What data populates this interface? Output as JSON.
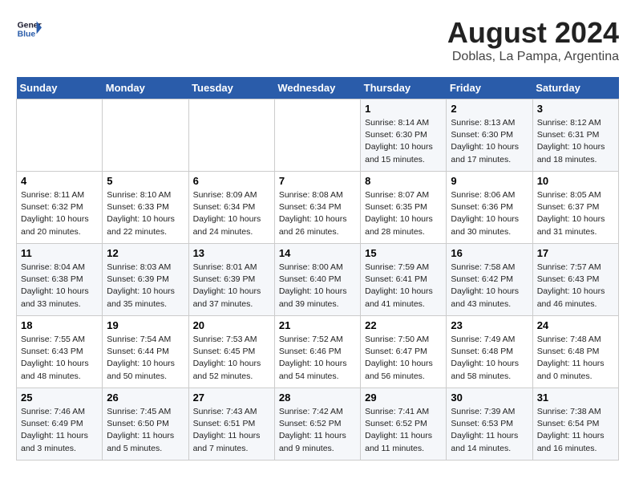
{
  "header": {
    "logo_line1": "General",
    "logo_line2": "Blue",
    "month_title": "August 2024",
    "location": "Doblas, La Pampa, Argentina"
  },
  "weekdays": [
    "Sunday",
    "Monday",
    "Tuesday",
    "Wednesday",
    "Thursday",
    "Friday",
    "Saturday"
  ],
  "weeks": [
    [
      {
        "day": "",
        "info": ""
      },
      {
        "day": "",
        "info": ""
      },
      {
        "day": "",
        "info": ""
      },
      {
        "day": "",
        "info": ""
      },
      {
        "day": "1",
        "info": "Sunrise: 8:14 AM\nSunset: 6:30 PM\nDaylight: 10 hours\nand 15 minutes."
      },
      {
        "day": "2",
        "info": "Sunrise: 8:13 AM\nSunset: 6:30 PM\nDaylight: 10 hours\nand 17 minutes."
      },
      {
        "day": "3",
        "info": "Sunrise: 8:12 AM\nSunset: 6:31 PM\nDaylight: 10 hours\nand 18 minutes."
      }
    ],
    [
      {
        "day": "4",
        "info": "Sunrise: 8:11 AM\nSunset: 6:32 PM\nDaylight: 10 hours\nand 20 minutes."
      },
      {
        "day": "5",
        "info": "Sunrise: 8:10 AM\nSunset: 6:33 PM\nDaylight: 10 hours\nand 22 minutes."
      },
      {
        "day": "6",
        "info": "Sunrise: 8:09 AM\nSunset: 6:34 PM\nDaylight: 10 hours\nand 24 minutes."
      },
      {
        "day": "7",
        "info": "Sunrise: 8:08 AM\nSunset: 6:34 PM\nDaylight: 10 hours\nand 26 minutes."
      },
      {
        "day": "8",
        "info": "Sunrise: 8:07 AM\nSunset: 6:35 PM\nDaylight: 10 hours\nand 28 minutes."
      },
      {
        "day": "9",
        "info": "Sunrise: 8:06 AM\nSunset: 6:36 PM\nDaylight: 10 hours\nand 30 minutes."
      },
      {
        "day": "10",
        "info": "Sunrise: 8:05 AM\nSunset: 6:37 PM\nDaylight: 10 hours\nand 31 minutes."
      }
    ],
    [
      {
        "day": "11",
        "info": "Sunrise: 8:04 AM\nSunset: 6:38 PM\nDaylight: 10 hours\nand 33 minutes."
      },
      {
        "day": "12",
        "info": "Sunrise: 8:03 AM\nSunset: 6:39 PM\nDaylight: 10 hours\nand 35 minutes."
      },
      {
        "day": "13",
        "info": "Sunrise: 8:01 AM\nSunset: 6:39 PM\nDaylight: 10 hours\nand 37 minutes."
      },
      {
        "day": "14",
        "info": "Sunrise: 8:00 AM\nSunset: 6:40 PM\nDaylight: 10 hours\nand 39 minutes."
      },
      {
        "day": "15",
        "info": "Sunrise: 7:59 AM\nSunset: 6:41 PM\nDaylight: 10 hours\nand 41 minutes."
      },
      {
        "day": "16",
        "info": "Sunrise: 7:58 AM\nSunset: 6:42 PM\nDaylight: 10 hours\nand 43 minutes."
      },
      {
        "day": "17",
        "info": "Sunrise: 7:57 AM\nSunset: 6:43 PM\nDaylight: 10 hours\nand 46 minutes."
      }
    ],
    [
      {
        "day": "18",
        "info": "Sunrise: 7:55 AM\nSunset: 6:43 PM\nDaylight: 10 hours\nand 48 minutes."
      },
      {
        "day": "19",
        "info": "Sunrise: 7:54 AM\nSunset: 6:44 PM\nDaylight: 10 hours\nand 50 minutes."
      },
      {
        "day": "20",
        "info": "Sunrise: 7:53 AM\nSunset: 6:45 PM\nDaylight: 10 hours\nand 52 minutes."
      },
      {
        "day": "21",
        "info": "Sunrise: 7:52 AM\nSunset: 6:46 PM\nDaylight: 10 hours\nand 54 minutes."
      },
      {
        "day": "22",
        "info": "Sunrise: 7:50 AM\nSunset: 6:47 PM\nDaylight: 10 hours\nand 56 minutes."
      },
      {
        "day": "23",
        "info": "Sunrise: 7:49 AM\nSunset: 6:48 PM\nDaylight: 10 hours\nand 58 minutes."
      },
      {
        "day": "24",
        "info": "Sunrise: 7:48 AM\nSunset: 6:48 PM\nDaylight: 11 hours\nand 0 minutes."
      }
    ],
    [
      {
        "day": "25",
        "info": "Sunrise: 7:46 AM\nSunset: 6:49 PM\nDaylight: 11 hours\nand 3 minutes."
      },
      {
        "day": "26",
        "info": "Sunrise: 7:45 AM\nSunset: 6:50 PM\nDaylight: 11 hours\nand 5 minutes."
      },
      {
        "day": "27",
        "info": "Sunrise: 7:43 AM\nSunset: 6:51 PM\nDaylight: 11 hours\nand 7 minutes."
      },
      {
        "day": "28",
        "info": "Sunrise: 7:42 AM\nSunset: 6:52 PM\nDaylight: 11 hours\nand 9 minutes."
      },
      {
        "day": "29",
        "info": "Sunrise: 7:41 AM\nSunset: 6:52 PM\nDaylight: 11 hours\nand 11 minutes."
      },
      {
        "day": "30",
        "info": "Sunrise: 7:39 AM\nSunset: 6:53 PM\nDaylight: 11 hours\nand 14 minutes."
      },
      {
        "day": "31",
        "info": "Sunrise: 7:38 AM\nSunset: 6:54 PM\nDaylight: 11 hours\nand 16 minutes."
      }
    ]
  ]
}
